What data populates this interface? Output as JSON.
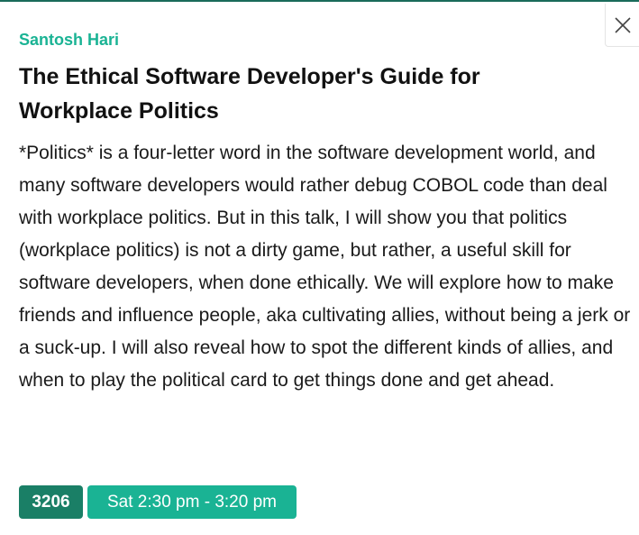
{
  "session": {
    "speaker": "Santosh Hari",
    "title": "The Ethical Software Developer's Guide for Workplace Politics",
    "description": "*Politics* is a four-letter word in the software development world, and many software developers would rather debug COBOL code than deal with workplace politics. But in this talk, I will show you that politics (workplace politics) is not a dirty game, but rather, a useful skill for software developers, when done ethically. We will explore how to make friends and influence people, aka cultivating allies, without being a jerk or a suck-up. I will also reveal how to spot the different kinds of allies, and when to play the political card to get things done and get ahead.",
    "room": "3206",
    "time": "Sat 2:30 pm - 3:20 pm"
  },
  "controls": {
    "close_icon": "close-icon"
  },
  "colors": {
    "accent": "#1ab394",
    "accent_dark": "#1a7f66",
    "top_border": "#1a6b5a"
  }
}
